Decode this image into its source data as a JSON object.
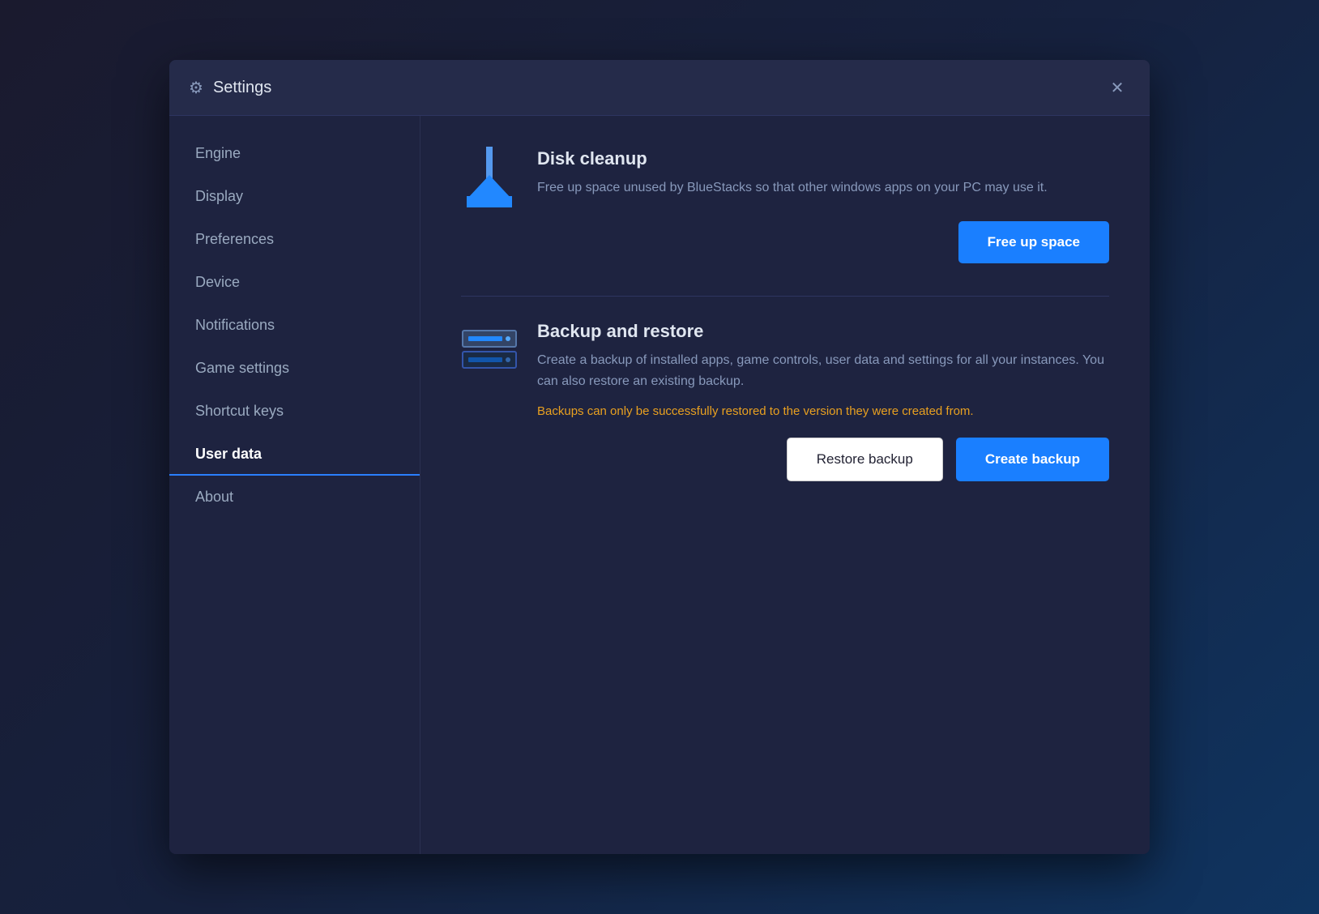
{
  "dialog": {
    "title": "Settings",
    "title_icon": "⚙",
    "close_label": "✕"
  },
  "sidebar": {
    "items": [
      {
        "id": "engine",
        "label": "Engine",
        "active": false
      },
      {
        "id": "display",
        "label": "Display",
        "active": false
      },
      {
        "id": "preferences",
        "label": "Preferences",
        "active": false
      },
      {
        "id": "device",
        "label": "Device",
        "active": false
      },
      {
        "id": "notifications",
        "label": "Notifications",
        "active": false
      },
      {
        "id": "game-settings",
        "label": "Game settings",
        "active": false
      },
      {
        "id": "shortcut-keys",
        "label": "Shortcut keys",
        "active": false
      },
      {
        "id": "user-data",
        "label": "User data",
        "active": true
      },
      {
        "id": "about",
        "label": "About",
        "active": false
      }
    ]
  },
  "main": {
    "disk_cleanup": {
      "title": "Disk cleanup",
      "description": "Free up space unused by BlueStacks so that other windows apps on your PC may use it.",
      "button_label": "Free up space"
    },
    "backup_restore": {
      "title": "Backup and restore",
      "description": "Create a backup of installed apps, game controls, user data and settings for all your instances. You can also restore an existing backup.",
      "warning": "Backups can only be successfully restored to the version they were created from.",
      "restore_button_label": "Restore backup",
      "create_button_label": "Create backup"
    }
  },
  "colors": {
    "primary_button": "#1a7fff",
    "warning_text": "#e8a020",
    "active_underline": "#2a7fff"
  }
}
